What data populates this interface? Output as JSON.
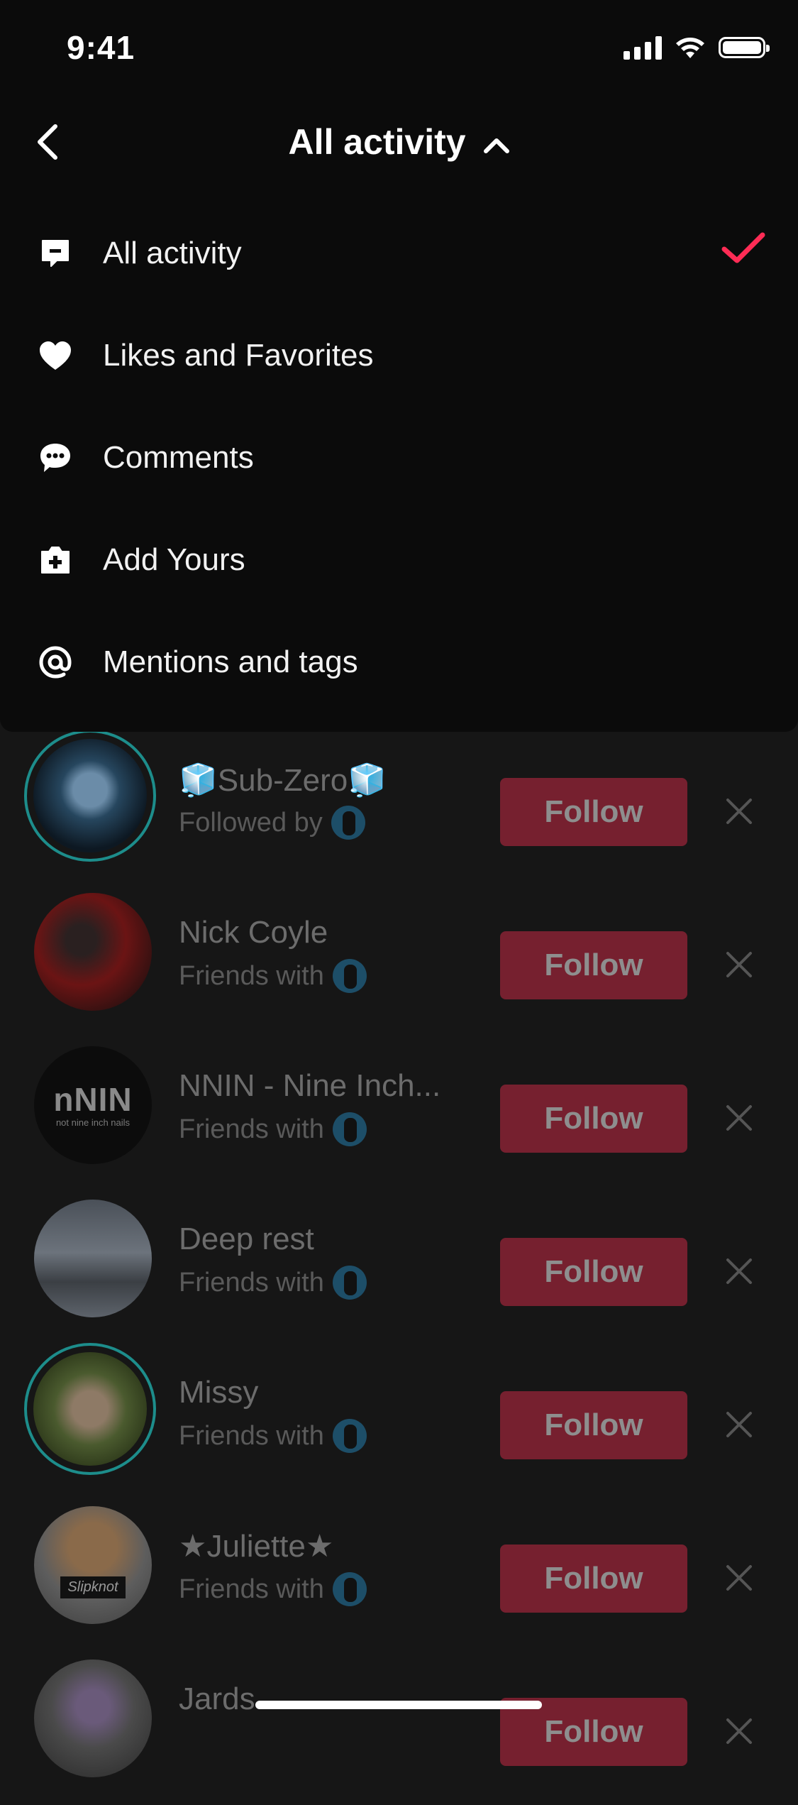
{
  "status_bar": {
    "time": "9:41"
  },
  "header": {
    "title": "All activity"
  },
  "menu": {
    "items": [
      {
        "label": "All activity",
        "icon": "notification-icon",
        "selected": true
      },
      {
        "label": "Likes and Favorites",
        "icon": "heart-icon",
        "selected": false
      },
      {
        "label": "Comments",
        "icon": "comment-icon",
        "selected": false
      },
      {
        "label": "Add Yours",
        "icon": "add-yours-icon",
        "selected": false
      },
      {
        "label": "Mentions and tags",
        "icon": "at-icon",
        "selected": false
      }
    ]
  },
  "suggestions": [
    {
      "name": "🧊Sub-Zero🧊",
      "subtitle": "Followed by",
      "follow_label": "Follow"
    },
    {
      "name": "Nick Coyle",
      "subtitle": "Friends with",
      "follow_label": "Follow"
    },
    {
      "name": "NNIN - Nine Inch...",
      "subtitle": "Friends with",
      "follow_label": "Follow",
      "avatar_text": "nNIN",
      "avatar_caption": "not nine inch nails"
    },
    {
      "name": "Deep rest",
      "subtitle": "Friends with",
      "follow_label": "Follow"
    },
    {
      "name": "Missy",
      "subtitle": "Friends with",
      "follow_label": "Follow"
    },
    {
      "name": "★Juliette★",
      "subtitle": "Friends with",
      "follow_label": "Follow",
      "avatar_text": "Slipknot"
    },
    {
      "name": "Jards",
      "subtitle": "",
      "follow_label": "Follow"
    }
  ],
  "colors": {
    "accent": "#fe2c55",
    "follow_dimmed": "#76202f",
    "ring": "#1d8d8b"
  }
}
